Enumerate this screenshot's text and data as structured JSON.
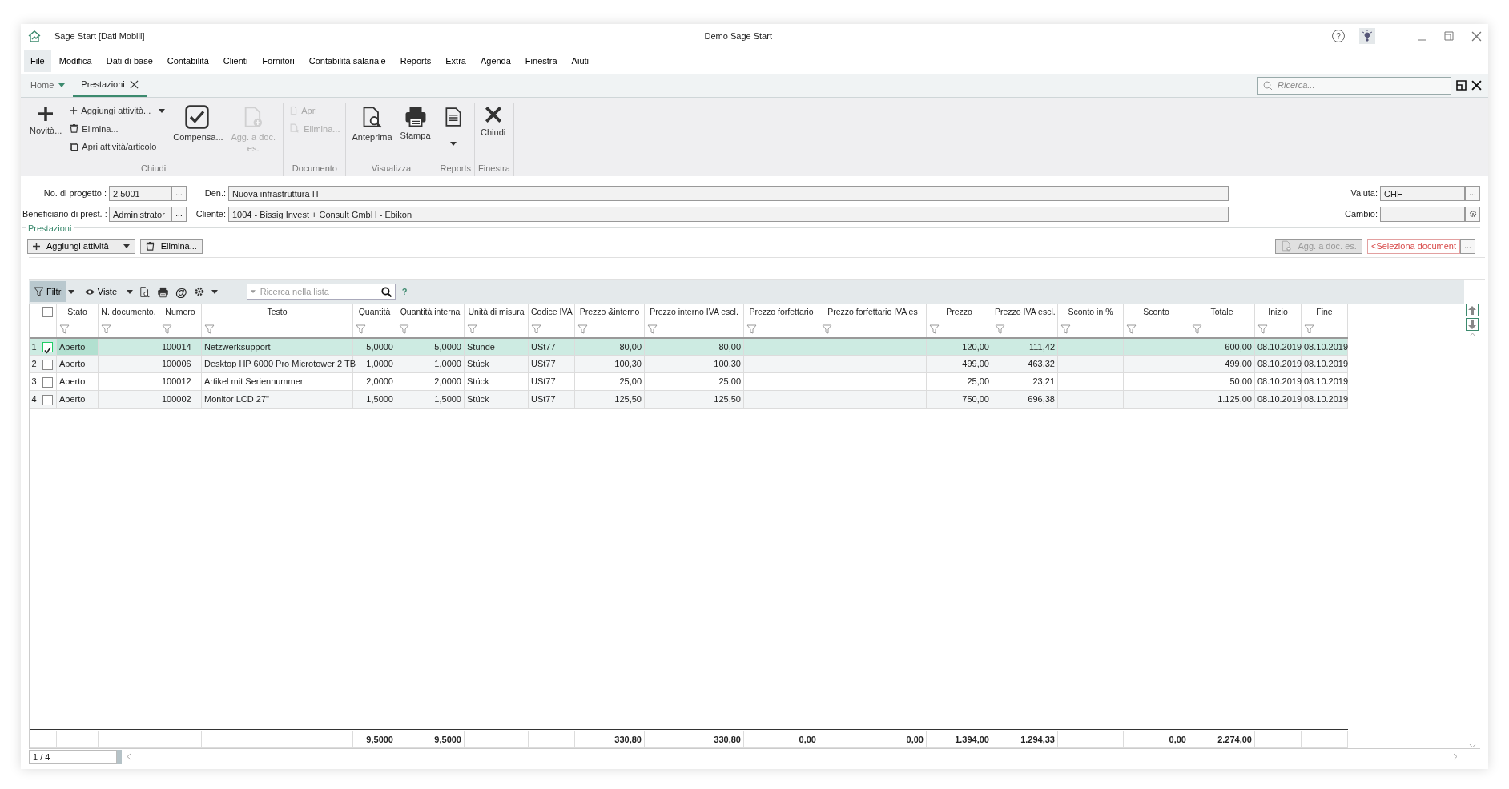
{
  "window": {
    "title": "Sage Start [Dati Mobili]",
    "center_title": "Demo Sage Start",
    "help_glyph": "?"
  },
  "menu": [
    {
      "label": "File",
      "selected": true
    },
    {
      "label": "Modifica",
      "selected": false
    },
    {
      "label": "Dati di base",
      "selected": false
    },
    {
      "label": "Contabilità",
      "selected": false
    },
    {
      "label": "Clienti",
      "selected": false
    },
    {
      "label": "Fornitori",
      "selected": false
    },
    {
      "label": "Contabilità salariale",
      "selected": false
    },
    {
      "label": "Reports",
      "selected": false
    },
    {
      "label": "Extra",
      "selected": false
    },
    {
      "label": "Agenda",
      "selected": false
    },
    {
      "label": "Finestra",
      "selected": false
    },
    {
      "label": "Aiuti",
      "selected": false
    }
  ],
  "tabs": [
    {
      "label": "Home",
      "selected": false,
      "dropdown": true,
      "closable": false
    },
    {
      "label": "Prestazioni",
      "selected": true,
      "dropdown": false,
      "closable": true
    }
  ],
  "search": {
    "placeholder": "Ricerca..."
  },
  "ribbon": [
    {
      "label": "Chiudi",
      "items": [
        {
          "kind": "large",
          "label": "Novità...",
          "disabled": false,
          "dropdown": false
        },
        {
          "kind": "small",
          "label": "Aggiungi attività...",
          "disabled": false,
          "dropdown": true
        },
        {
          "kind": "small",
          "label": "Elimina...",
          "disabled": false,
          "dropdown": false
        },
        {
          "kind": "small",
          "label": "Apri attività/articolo",
          "disabled": false,
          "dropdown": false
        },
        {
          "kind": "large",
          "label": "Compensa...",
          "disabled": false,
          "dropdown": false
        },
        {
          "kind": "large",
          "label": "Agg. a doc. es.",
          "disabled": true,
          "dropdown": false
        }
      ]
    },
    {
      "label": "Documento",
      "items": [
        {
          "kind": "small",
          "label": "Apri",
          "disabled": true,
          "dropdown": false
        },
        {
          "kind": "small",
          "label": "Elimina...",
          "disabled": true,
          "dropdown": false
        }
      ]
    },
    {
      "label": "Visualizza",
      "items": [
        {
          "kind": "large",
          "label": "Anteprima",
          "disabled": false,
          "dropdown": false
        },
        {
          "kind": "large",
          "label": "Stampa",
          "disabled": false,
          "dropdown": false
        }
      ]
    },
    {
      "label": "Reports",
      "items": [
        {
          "kind": "large",
          "disabled": false,
          "dropdown": true
        }
      ]
    },
    {
      "label": "Finestra",
      "items": [
        {
          "kind": "large",
          "label": "Chiudi",
          "disabled": false,
          "dropdown": false
        }
      ]
    }
  ],
  "form": {
    "rows": [
      [
        {
          "label": "No. di progetto :",
          "value": "2.5001",
          "button": {
            "kind": "text",
            "label": "..."
          }
        },
        {
          "label": "Den.:",
          "value": "Nuova infrastruttura IT"
        },
        {
          "label": "Valuta:",
          "value": "CHF",
          "button": {
            "kind": "text",
            "label": "..."
          }
        }
      ],
      [
        {
          "label": "Beneficiario di prest. :",
          "value": "Administrator",
          "button": {
            "kind": "text",
            "label": "..."
          }
        },
        {
          "label": "Cliente:",
          "value": "1004 - Bissig Invest + Consult GmbH - Ebikon"
        },
        {
          "label": "Cambio:",
          "button": {
            "kind": "gear"
          }
        }
      ]
    ]
  },
  "section": {
    "title": "Prestazioni",
    "left_buttons": [
      {
        "label": "Aggiungi attività",
        "dropdown": true,
        "disabled": false
      },
      {
        "label": "Elimina...",
        "dropdown": false,
        "disabled": false
      }
    ],
    "right_buttons": [
      {
        "label": "Agg. a doc. es.",
        "dropdown": false,
        "disabled": true
      }
    ],
    "document_field": {
      "placeholder": "<Seleziona document",
      "button": "..."
    }
  },
  "grid_toolbar": {
    "filters": {
      "label": "Filtri",
      "selected": true
    },
    "views": {
      "label": "Viste"
    },
    "at_symbol": "@",
    "search_placeholder": "Ricerca nella lista",
    "help": "?"
  },
  "table": {
    "all_checked": false,
    "columns": [
      {
        "label": "Stato",
        "kind": "text"
      },
      {
        "label": "N. documento.",
        "kind": "text"
      },
      {
        "label": "Numero",
        "kind": "text"
      },
      {
        "label": "Testo",
        "kind": "text"
      },
      {
        "label": "Quantità",
        "kind": "number"
      },
      {
        "label": "Quantità interna",
        "kind": "number"
      },
      {
        "label": "Unità di misura",
        "kind": "text"
      },
      {
        "label": "Codice IVA",
        "kind": "text"
      },
      {
        "label": "Prezzo &interno",
        "kind": "number"
      },
      {
        "label": "Prezzo interno IVA escl.",
        "kind": "number"
      },
      {
        "label": "Prezzo forfettario",
        "kind": "number"
      },
      {
        "label": "Prezzo forfettario IVA es",
        "kind": "number"
      },
      {
        "label": "Prezzo",
        "kind": "number"
      },
      {
        "label": "Prezzo IVA escl.",
        "kind": "number"
      },
      {
        "label": "Sconto in %",
        "kind": "number"
      },
      {
        "label": "Sconto",
        "kind": "number"
      },
      {
        "label": "Totale",
        "kind": "number"
      },
      {
        "label": "Inizio",
        "kind": "text"
      },
      {
        "label": "Fine",
        "kind": "text"
      }
    ],
    "rows": [
      {
        "number": "1",
        "checked": true,
        "selected": true,
        "cells": [
          {
            "text": "Aperto"
          },
          {},
          {
            "text": "100014"
          },
          {
            "text": "Netzwerksupport"
          },
          {
            "text": "5,0000"
          },
          {
            "text": "5,0000"
          },
          {
            "text": "Stunde"
          },
          {
            "text": "USt77"
          },
          {
            "text": "80,00"
          },
          {
            "text": "80,00"
          },
          {},
          {},
          {
            "text": "120,00"
          },
          {
            "text": "111,42"
          },
          {},
          {},
          {
            "text": "600,00"
          },
          {
            "text": "08.10.2019"
          },
          {
            "text": "08.10.2019"
          }
        ]
      },
      {
        "number": "2",
        "checked": false,
        "selected": false,
        "cells": [
          {
            "text": "Aperto"
          },
          {},
          {
            "text": "100006"
          },
          {
            "text": "Desktop HP 6000 Pro Microtower 2 TB"
          },
          {
            "text": "1,0000"
          },
          {
            "text": "1,0000"
          },
          {
            "text": "Stück"
          },
          {
            "text": "USt77"
          },
          {
            "text": "100,30"
          },
          {
            "text": "100,30"
          },
          {},
          {},
          {
            "text": "499,00"
          },
          {
            "text": "463,32"
          },
          {},
          {},
          {
            "text": "499,00"
          },
          {
            "text": "08.10.2019"
          },
          {
            "text": "08.10.2019"
          }
        ]
      },
      {
        "number": "3",
        "checked": false,
        "selected": false,
        "cells": [
          {
            "text": "Aperto"
          },
          {},
          {
            "text": "100012"
          },
          {
            "text": "Artikel mit Seriennummer"
          },
          {
            "text": "2,0000"
          },
          {
            "text": "2,0000"
          },
          {
            "text": "Stück"
          },
          {
            "text": "USt77"
          },
          {
            "text": "25,00"
          },
          {
            "text": "25,00"
          },
          {},
          {},
          {
            "text": "25,00"
          },
          {
            "text": "23,21"
          },
          {},
          {},
          {
            "text": "50,00"
          },
          {
            "text": "08.10.2019"
          },
          {
            "text": "08.10.2019"
          }
        ]
      },
      {
        "number": "4",
        "checked": false,
        "selected": false,
        "cells": [
          {
            "text": "Aperto"
          },
          {},
          {
            "text": "100002"
          },
          {
            "text": "Monitor LCD 27\""
          },
          {
            "text": "1,5000"
          },
          {
            "text": "1,5000"
          },
          {
            "text": "Stück"
          },
          {
            "text": "USt77"
          },
          {
            "text": "125,50"
          },
          {
            "text": "125,50"
          },
          {},
          {},
          {
            "text": "750,00"
          },
          {
            "text": "696,38"
          },
          {},
          {},
          {
            "text": "1.125,00"
          },
          {
            "text": "08.10.2019"
          },
          {
            "text": "08.10.2019"
          }
        ]
      }
    ],
    "totals": {
      "cells": [
        {},
        {},
        {},
        {},
        {
          "text": "9,5000"
        },
        {
          "text": "9,5000"
        },
        {},
        {},
        {
          "text": "330,80"
        },
        {
          "text": "330,80"
        },
        {
          "text": "0,00"
        },
        {
          "text": "0,00"
        },
        {
          "text": "1.394,00"
        },
        {
          "text": "1.294,33"
        },
        {},
        {
          "text": "0,00"
        },
        {
          "text": "2.274,00"
        },
        {},
        {}
      ]
    }
  },
  "status_bar": {
    "record_position": "1 / 4"
  }
}
